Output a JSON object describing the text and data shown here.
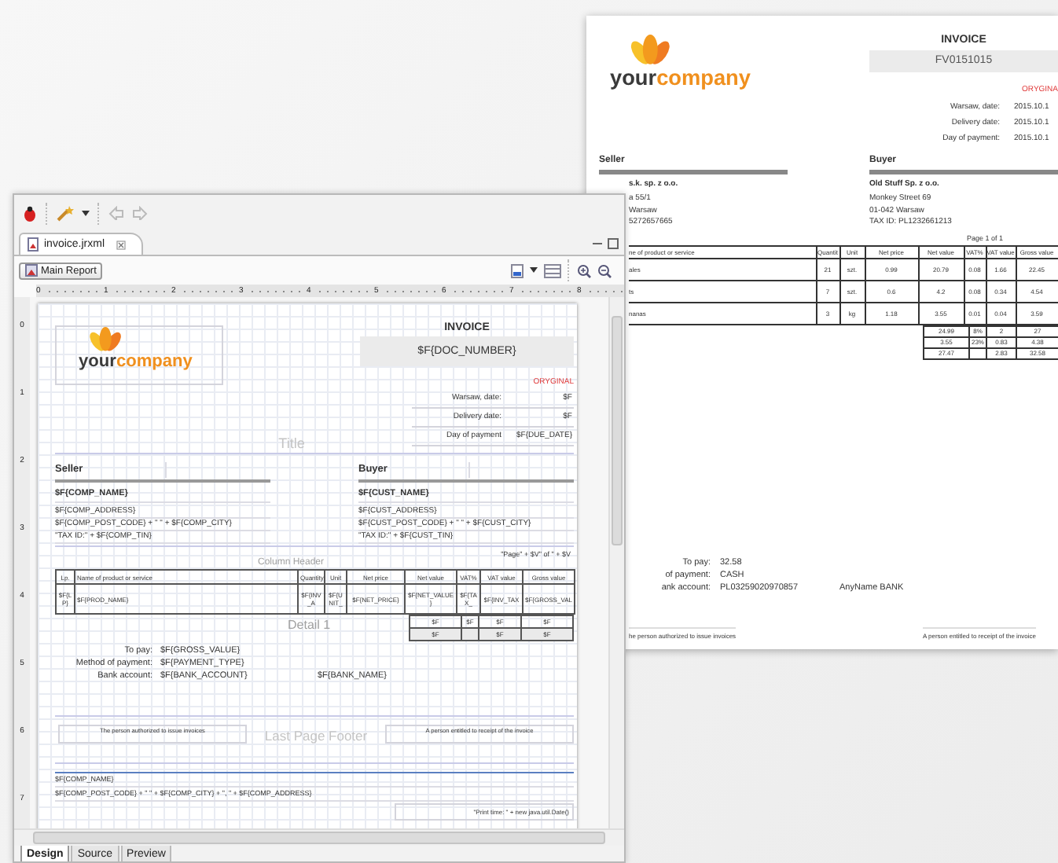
{
  "preview": {
    "logo": {
      "part1": "your",
      "part2": "company"
    },
    "title": "INVOICE",
    "doc_number": "FV0151015",
    "original": "ORYGINA",
    "dates": [
      {
        "label": "Warsaw, date:",
        "value": "2015.10.1"
      },
      {
        "label": "Delivery date:",
        "value": "2015.10.1"
      },
      {
        "label": "Day of payment:",
        "value": "2015.10.1"
      }
    ],
    "seller": {
      "heading": "Seller",
      "lines": [
        "s.k. sp. z o.o.",
        "a 55/1",
        "Warsaw",
        "5272657665"
      ]
    },
    "buyer": {
      "heading": "Buyer",
      "lines": [
        "Old Stuff Sp. z o.o.",
        "Monkey Street 69",
        "01-042 Warsaw",
        "TAX ID: PL1232661213"
      ]
    },
    "page_label": "Page 1 of 1",
    "table": {
      "columns": [
        "ne of product or service",
        "Quantit",
        "Unit",
        "Net price",
        "Net value",
        "VAT%",
        "VAT value",
        "Gross value"
      ],
      "rows": [
        [
          "ales",
          "21",
          "szt.",
          "0.99",
          "20.79",
          "0.08",
          "1.66",
          "22.45"
        ],
        [
          "ts",
          "7",
          "szt.",
          "0.6",
          "4.2",
          "0.08",
          "0.34",
          "4.54"
        ],
        [
          "nanas",
          "3",
          "kg",
          "1.18",
          "3.55",
          "0.01",
          "0.04",
          "3.59"
        ]
      ]
    },
    "totals": [
      {
        "net": "24.99",
        "vat_rate": "8%",
        "vat": "2",
        "gross": "27"
      },
      {
        "net": "3.55",
        "vat_rate": "23%",
        "vat": "0.83",
        "gross": "4.38"
      },
      {
        "net": "27.47",
        "vat": "2.83",
        "gross": "32.58"
      }
    ],
    "payment": [
      {
        "label": "To pay:",
        "value": "32.58"
      },
      {
        "label": "of payment:",
        "value": "CASH"
      },
      {
        "label": "ank account:",
        "value": "PL03259020970857",
        "extra": "AnyName BANK"
      }
    ],
    "signatures": [
      "he person authorized to issue invoices",
      "A person entitled to receipt of the invoice"
    ]
  },
  "editor": {
    "file_tab": "invoice.jrxml",
    "report_button": "Main Report",
    "ruler_h": [
      "0",
      "1",
      "2",
      "3",
      "4",
      "5",
      "6",
      "7",
      "8"
    ],
    "ruler_v": [
      "0",
      "1",
      "2",
      "3",
      "4",
      "5",
      "6",
      "7"
    ],
    "design": {
      "title_band": "Title",
      "logo": {
        "part1": "your",
        "part2": "company"
      },
      "title": "INVOICE",
      "doc_number": "$F{DOC_NUMBER}",
      "original": "ORYGINAL",
      "dates": [
        {
          "label": "Warsaw, date:",
          "value": "$F"
        },
        {
          "label": "Delivery date:",
          "value": "$F"
        },
        {
          "label": "Day of payment",
          "value": "$F{DUE_DATE}"
        }
      ],
      "seller": {
        "heading": "Seller",
        "name": "$F{COMP_NAME}",
        "lines": [
          "$F{COMP_ADDRESS}",
          "$F{COMP_POST_CODE} + \" \" + $F{COMP_CITY}",
          "\"TAX ID:\" + $F{COMP_TIN}"
        ]
      },
      "buyer": {
        "heading": "Buyer",
        "name": "$F{CUST_NAME}",
        "lines": [
          "$F{CUST_ADDRESS}",
          "$F{CUST_POST_CODE} + \" \" + $F{CUST_CITY}",
          "\"TAX ID:\" + $F{CUST_TIN}"
        ]
      },
      "page_expr": "\"Page\" + $V\" of \" + $V",
      "column_header_band": "Column Header",
      "table": {
        "columns": [
          "Lp.",
          "Name of product or service",
          "Quantity",
          "Unit",
          "Net price",
          "Net value",
          "VAT%",
          "VAT value",
          "Gross value"
        ],
        "row": [
          "$F{LP}",
          "$F{PROD_NAME}",
          "$F{INV_A",
          "$F{UNIT_",
          "$F{NET_PRICE}",
          "$F{NET_VALUE}",
          "$F{TAX_",
          "$F{INV_TAX",
          "$F{GROSS_VAL"
        ]
      },
      "detail_band": "Detail 1",
      "totals": [
        {
          "net": "$F",
          "vat_rate": "$F",
          "vat": "$F",
          "gross": "$F"
        },
        {
          "net": "$F",
          "vat": "$F",
          "gross": "$F"
        }
      ],
      "payment": [
        {
          "label": "To pay:",
          "value": "$F{GROSS_VALUE}"
        },
        {
          "label": "Method of payment:",
          "value": "$F{PAYMENT_TYPE}"
        },
        {
          "label": "Bank account:",
          "value": "$F{BANK_ACCOUNT}",
          "extra": "$F{BANK_NAME}"
        }
      ],
      "signatures": [
        "The person authorized to issue invoices",
        "A person entitled to receipt of the invoice"
      ],
      "footer_band": "Last Page Footer",
      "footer_lines": [
        "$F{COMP_NAME}",
        "$F{COMP_POST_CODE} + \" \" + $F{COMP_CITY} + \", \" + $F{COMP_ADDRESS}"
      ],
      "print_time": "\"Print time: \" + new java.util.Date()"
    },
    "bottom_tabs": [
      {
        "label": "Design",
        "selected": true
      },
      {
        "label": "Source",
        "selected": false
      },
      {
        "label": "Preview",
        "selected": false
      }
    ]
  }
}
